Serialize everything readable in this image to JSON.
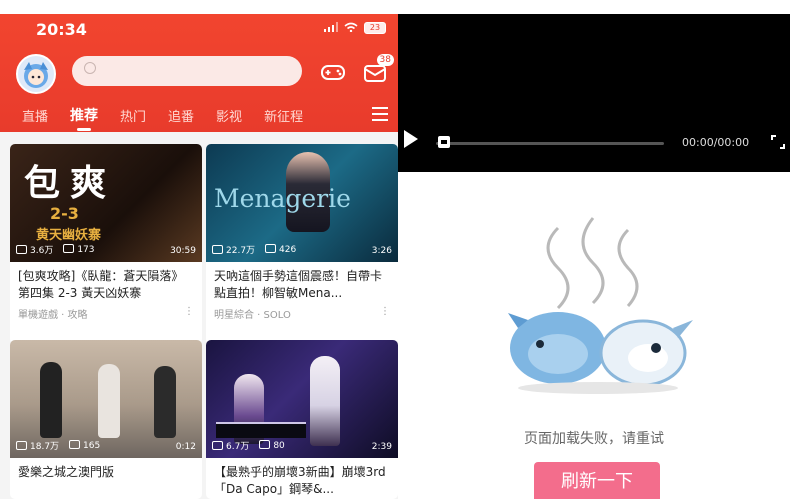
{
  "status_bar": {
    "time": "20:34",
    "battery": "23"
  },
  "header": {
    "mail_badge": "38",
    "tabs": [
      "直播",
      "推荐",
      "热门",
      "追番",
      "影视",
      "新征程"
    ]
  },
  "cards": [
    {
      "thumb_text": "包爽",
      "thumb_sub": "2-3",
      "thumb_caption": "黄天幽妖寨",
      "views": "3.6万",
      "danmaku": "173",
      "duration": "30:59",
      "title": "[包爽攻略]《臥龍：蒼天隕落》第四集 2-3 黃天凶妖寨",
      "channel": "單機遊戲 · 攻略"
    },
    {
      "thumb_text": "Menagerie",
      "views": "22.7万",
      "danmaku": "426",
      "duration": "3:26",
      "title": "天吶這個手勢這個震感！自帶卡點直拍！柳智敏Mena...",
      "channel": "明星綜合 · SOLO"
    },
    {
      "views": "18.7万",
      "danmaku": "165",
      "duration": "0:12",
      "title": "愛樂之城之澳門版",
      "channel": ""
    },
    {
      "views": "6.7万",
      "danmaku": "80",
      "duration": "2:39",
      "title": "【最熟乎的崩壞3新曲】崩壞3rd「Da Capo」鋼琴&...",
      "channel": ""
    }
  ],
  "player": {
    "time": "00:00/00:00"
  },
  "error": {
    "message": "页面加载失败，请重试",
    "button": "刷新一下"
  },
  "colors": {
    "brand_red": "#e83b2c",
    "refresh_pink": "#f36d8c"
  }
}
